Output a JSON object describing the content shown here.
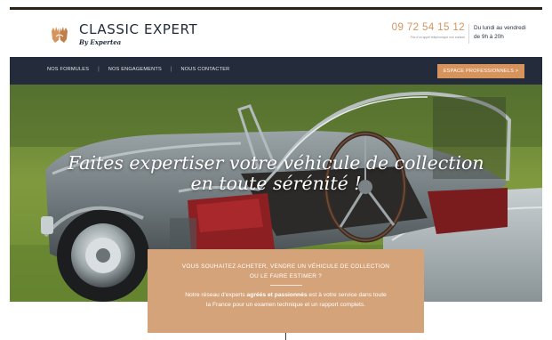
{
  "header": {
    "brand_name": "CLASSIC EXPERT",
    "brand_tagline": "By Expertea",
    "phone": "09 72 54 15 12",
    "phone_note": "Prix d'un appel téléphonique non surtaxé",
    "hours_line1": "Du lundi au vendredi",
    "hours_line2": "de 9h à 20h",
    "logo_icon": "hands-icon"
  },
  "nav": {
    "items": [
      {
        "label": "NOS FORMULES"
      },
      {
        "label": "NOS ENGAGEMENTS"
      },
      {
        "label": "NOUS CONTACTER"
      }
    ],
    "separator": "|",
    "pro_button": "ESPACE PROFESSIONNELS >"
  },
  "hero": {
    "headline_line1": "Faites expertiser votre véhicule de collection",
    "headline_line2": "en toute sérénité !"
  },
  "info_card": {
    "title_line1": "VOUS SOUHAITEZ ACHETER, VENDRE UN VÉHICULE DE COLLECTION",
    "title_line2": "OU LE FAIRE ESTIMER ?",
    "body_part1": "Notre réseau d'experts ",
    "body_bold": "agréés et passionnés",
    "body_part2": " est à votre service dans toute",
    "body_line2": "la France pour un examen technique et un rapport complets."
  },
  "colors": {
    "accent": "#d7935c",
    "navbar": "#242c3b",
    "card": "#d5a37a",
    "text_dark": "#1f2a3a"
  }
}
